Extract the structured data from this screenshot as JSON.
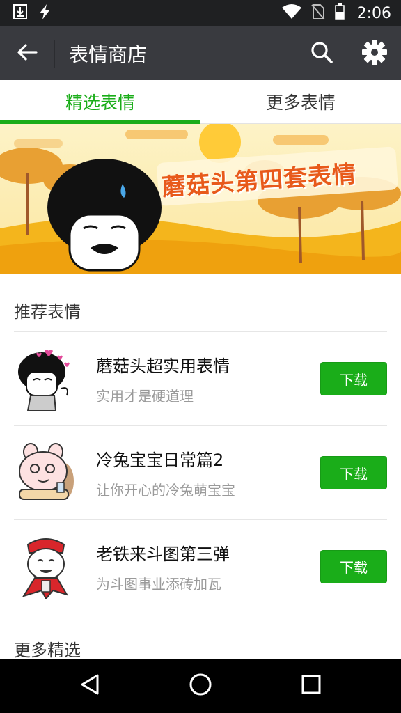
{
  "status_bar": {
    "time": "2:06",
    "left_icons": [
      "download-icon",
      "flash-icon"
    ],
    "right_icons": [
      "wifi-icon",
      "no-sim-icon",
      "battery-icon"
    ]
  },
  "app_bar": {
    "title": "表情商店",
    "back_icon": "arrow-left-icon",
    "actions": [
      "search-icon",
      "gear-icon"
    ]
  },
  "tabs": [
    {
      "label": "精选表情",
      "active": true
    },
    {
      "label": "更多表情",
      "active": false
    }
  ],
  "banner": {
    "text": "蘑菇头第四套表情"
  },
  "recommended": {
    "title": "推荐表情",
    "items": [
      {
        "title": "蘑菇头超实用表情",
        "subtitle": "实用才是硬道理",
        "button": "下载"
      },
      {
        "title": "冷兔宝宝日常篇2",
        "subtitle": "让你开心的冷兔萌宝宝",
        "button": "下载"
      },
      {
        "title": "老铁来斗图第三弹",
        "subtitle": "为斗图事业添砖加瓦",
        "button": "下载"
      }
    ]
  },
  "more_section": {
    "title": "更多精选"
  },
  "nav_bar": {
    "buttons": [
      "back-triangle-icon",
      "home-circle-icon",
      "recents-square-icon"
    ]
  },
  "colors": {
    "accent": "#1aad19",
    "appbar": "#393a3f",
    "statusbar": "#1f2022"
  }
}
